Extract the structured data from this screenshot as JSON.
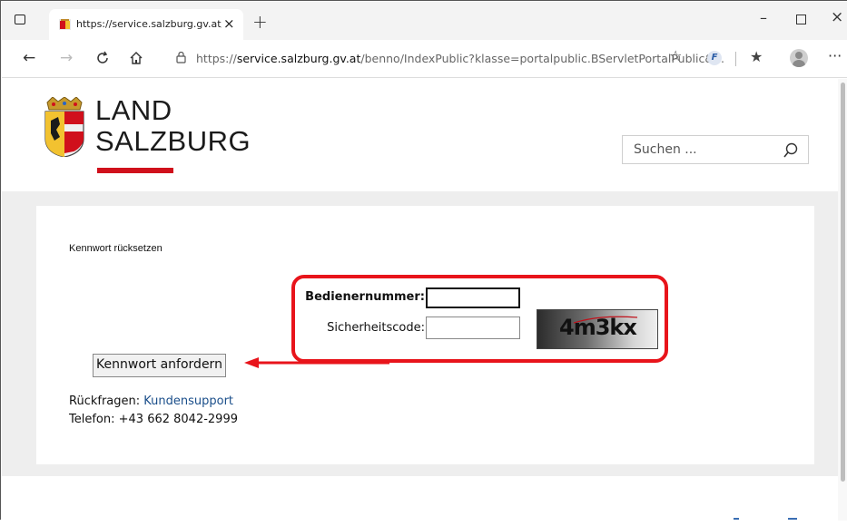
{
  "browser": {
    "tab_title": "https://service.salzburg.gv.at/ben",
    "tab_close": "×",
    "new_tab": "+",
    "window_min": "–",
    "window_close": "×",
    "url_prefix": "https://",
    "url_host": "service.salzburg.gv.at",
    "url_path": "/benno/IndexPublic?klasse=portalpublic.BServletPortalPublic&...",
    "more": "···"
  },
  "header": {
    "brand_line1": "LAND",
    "brand_line2": "SALZBURG",
    "search_placeholder": "Suchen ..."
  },
  "form": {
    "title": "Kennwort rücksetzen",
    "user_label": "Bedienernummer:",
    "user_value": "",
    "code_label": "Sicherheitscode:",
    "code_value": "",
    "captcha_text": "4m3kx",
    "submit_label": "Kennwort anfordern"
  },
  "support": {
    "question_label": "Rückfragen:",
    "link_label": "Kundensupport",
    "phone_label": "Telefon: +43 662 8042-2999"
  },
  "colors": {
    "brand_red": "#d0101c",
    "annotation_red": "#e8141b",
    "link_blue": "#1a4e8a"
  }
}
